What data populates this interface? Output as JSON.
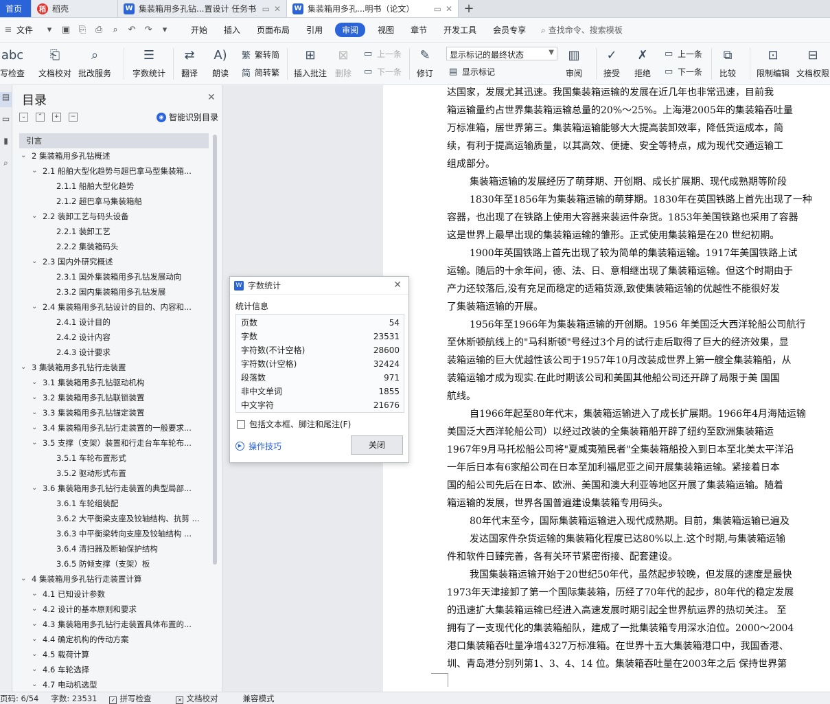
{
  "tabs": {
    "home": "首页",
    "daoke": "稻壳",
    "doc1": "集装箱用多孔钻...置设计 任务书",
    "doc2": "集装箱用多孔...明书（论文）",
    "add": "+"
  },
  "menu": {
    "file": "文件",
    "items": [
      "开始",
      "插入",
      "页面布局",
      "引用",
      "审阅",
      "视图",
      "章节",
      "开发工具",
      "会员专享"
    ],
    "selected": "审阅",
    "search": "查找命令、搜索模板"
  },
  "ribbon": {
    "spellcheck": "写检查",
    "doc_proof": "文档校对",
    "batch_service": "批改服务",
    "word_count": "字数统计",
    "translate": "翻译",
    "read_aloud": "朗读",
    "to_traditional": "繁转简",
    "to_simplified": "简转繁",
    "insert_comment": "插入批注",
    "delete": "删除",
    "prev_comment": "上一条",
    "next_comment": "下一条",
    "revise": "修订",
    "markup_combo": "显示标记的最终状态",
    "show_markup": "显示标记",
    "review": "审阅",
    "accept": "接受",
    "reject": "拒绝",
    "prev_change": "上一条",
    "next_change": "下一条",
    "compare": "比较",
    "restrict_edit": "限制编辑",
    "doc_rights": "文档权限"
  },
  "toc": {
    "title": "目录",
    "smart_button": "智能识别目录",
    "items": [
      {
        "text": "引言",
        "level": 0
      },
      {
        "text": "2 集装箱用多孔钻概述",
        "level": 1
      },
      {
        "text": "2.1 船舶大型化趋势与超巴拿马型集装箱...",
        "level": 2
      },
      {
        "text": "2.1.1 船舶大型化趋势",
        "level": 3
      },
      {
        "text": "2.1.2 超巴拿马集装箱船",
        "level": 3
      },
      {
        "text": "2.2 装卸工艺与码头设备",
        "level": 2
      },
      {
        "text": "2.2.1 装卸工艺",
        "level": 3
      },
      {
        "text": "2.2.2 集装箱码头",
        "level": 3
      },
      {
        "text": "2.3 国内外研究概述",
        "level": 2
      },
      {
        "text": "2.3.1 国外集装箱用多孔钻发展动向",
        "level": 3
      },
      {
        "text": "2.3.2 国内集装箱用多孔钻发展",
        "level": 3
      },
      {
        "text": "2.4 集装箱用多孔钻设计的目的、内容和...",
        "level": 2
      },
      {
        "text": "2.4.1 设计目的",
        "level": 3
      },
      {
        "text": "2.4.2 设计内容",
        "level": 3
      },
      {
        "text": "2.4.3 设计要求",
        "level": 3
      },
      {
        "text": "3 集装箱用多孔钻行走装置",
        "level": 1
      },
      {
        "text": "3.1 集装箱用多孔钻驱动机构",
        "level": 2
      },
      {
        "text": "3.2 集装箱用多孔钻联锁装置",
        "level": 2
      },
      {
        "text": "3.3 集装箱用多孔钻锚定装置",
        "level": 2
      },
      {
        "text": "3.4 集装箱用多孔钻行走装置的一般要求...",
        "level": 2
      },
      {
        "text": "3.5 支撑（支架）装置和行走台车车轮布...",
        "level": 2
      },
      {
        "text": "3.5.1 车轮布置形式",
        "level": 3
      },
      {
        "text": "3.5.2 驱动形式布置",
        "level": 3
      },
      {
        "text": "3.6 集装箱用多孔钻行走装置的典型局部...",
        "level": 2
      },
      {
        "text": "3.6.1 车轮组装配",
        "level": 3
      },
      {
        "text": "3.6.2 大平衡梁支座及铰轴结构、抗剪 ...",
        "level": 3
      },
      {
        "text": "3.6.3 中平衡梁转向支座及铰轴结构 ...",
        "level": 3
      },
      {
        "text": "3.6.4 清扫器及断轴保护结构",
        "level": 3
      },
      {
        "text": "3.6.5 防倾支撑（支架）板",
        "level": 3
      },
      {
        "text": "4 集装箱用多孔钻行走装置计算",
        "level": 1
      },
      {
        "text": "4.1 已知设计参数",
        "level": 2
      },
      {
        "text": "4.2 设计的基本原则和要求",
        "level": 2
      },
      {
        "text": "4.3 集装箱用多孔钻行走装置具体布置的...",
        "level": 2
      },
      {
        "text": "4.4 确定机构的传动方案",
        "level": 2
      },
      {
        "text": "4.5 载荷计算",
        "level": 2
      },
      {
        "text": "4.6 车轮选择",
        "level": 2
      },
      {
        "text": "4.7 电动机选型",
        "level": 2
      }
    ]
  },
  "dialog": {
    "title": "字数统计",
    "section": "统计信息",
    "rows": [
      {
        "label": "页数",
        "value": "54"
      },
      {
        "label": "字数",
        "value": "23531"
      },
      {
        "label": "字符数(不计空格)",
        "value": "28600"
      },
      {
        "label": "字符数(计空格)",
        "value": "32424"
      },
      {
        "label": "段落数",
        "value": "971"
      },
      {
        "label": "非中文单词",
        "value": "1855"
      },
      {
        "label": "中文字符",
        "value": "21676"
      }
    ],
    "checkbox": "包括文本框、脚注和尾注(F)",
    "tip": "操作技巧",
    "close": "关闭"
  },
  "document": {
    "lines": [
      {
        "text": "达国家，发展尤其迅速。我国集装箱运输的发展在近几年也非常迅速，目前我",
        "indent": false
      },
      {
        "text": "箱运输量约占世界集装箱运输总量的20%～25%。上海港2005年的集装箱吞吐量",
        "indent": false
      },
      {
        "text": "万标准箱，居世界第三。集装箱运输能够大大提高装卸效率，降低货运成本，简",
        "indent": false
      },
      {
        "text": "续，有利于提高运输质量，以其高效、便捷、安全等特点，成为现代交通运输工",
        "indent": false
      },
      {
        "text": "组成部分。",
        "indent": false
      },
      {
        "text": "集装箱运输的发展经历了萌芽期、开创期、成长扩展期、现代成熟期等阶段",
        "indent": true
      },
      {
        "text": "1830年至1856年为集装箱运输的萌芽期。1830年在英国铁路上首先出现了一种",
        "indent": true
      },
      {
        "text": "容器，也出现了在铁路上使用大容器来装运件杂货。1853年美国铁路也采用了容器",
        "indent": false
      },
      {
        "text": "这是世界上最早出现的集装箱运输的雏形。正式使用集装箱是在20 世纪初期。",
        "indent": false
      },
      {
        "text": "1900年英国铁路上首先出现了较为简单的集装箱运输。1917年美国铁路上试",
        "indent": true
      },
      {
        "text": "运输。随后的十余年间，德、法、日、意相继出现了集装箱运输。但这个时期由于",
        "indent": false
      },
      {
        "text": "产力还较落后,没有充足而稳定的适箱货源,致使集装箱运输的优越性不能很好发",
        "indent": false
      },
      {
        "text": "了集装箱运输的开展。",
        "indent": false
      },
      {
        "text": "1956年至1966年为集装箱运输的开创期。1956 年美国泛大西洋轮船公司航行",
        "indent": true
      },
      {
        "text": "至休斯顿航线上的\"马科斯顿\"号经过3个月的试行走后取得了巨大的经济效果，显",
        "indent": false
      },
      {
        "text": "装箱运输的巨大优越性该公司于1957年10月改装成世界上第一艘全集装箱船，从",
        "indent": false
      },
      {
        "text": "装箱运输才成为现实.在此时期该公司和美国其他船公司还开辟了局限于美 国国",
        "indent": false
      },
      {
        "text": "航线。",
        "indent": false
      },
      {
        "text": "自1966年起至80年代末，集装箱运输进入了成长扩展期。1966年4月海陆运输",
        "indent": true
      },
      {
        "text": "美国泛大西洋轮船公司）以经过改装的全集装箱船开辟了纽约至欧洲集装箱运",
        "indent": false
      },
      {
        "text": "1967年9月马托松船公司将\"夏威夷殖民者\"全集装箱船投入到日本至北美太平洋沿",
        "indent": false
      },
      {
        "text": "一年后日本有6家船公司在日本至加利福尼亚之间开展集装箱运输。紧接着日本",
        "indent": false
      },
      {
        "text": "国的船公司先后在日本、欧洲、美国和澳大利亚等地区开展了集装箱运输。随着",
        "indent": false
      },
      {
        "text": "箱运输的发展，世界各国普遍建设集装箱专用码头。",
        "indent": false
      },
      {
        "text": "80年代末至今，国际集装箱运输进入现代成熟期。目前，集装箱运输已遍及",
        "indent": true
      },
      {
        "text": "发达国家件杂货运输的集装箱化程度已达80%以上.这个时期,与集装箱运输",
        "indent": true
      },
      {
        "text": "件和软件日臻完善，各有关环节紧密衔接、配套建设。",
        "indent": false
      },
      {
        "text": "我国集装箱运输开始于20世纪50年代，虽然起步较晚，但发展的速度是最快",
        "indent": true
      },
      {
        "text": "1973年天津接卸了第一个国际集装箱，历经了70年代的起步，80年代的稳定发展",
        "indent": false
      },
      {
        "text": "的迅速扩大集装箱运输已经进入高速发展时期引起全世界航运界的热切关注。 至",
        "indent": false
      },
      {
        "text": "拥有了一支现代化的集装箱船队，建成了一批集装箱专用深水泊位。2000～2004",
        "indent": false
      },
      {
        "text": "港口集装箱吞吐量净增4327万标准箱。在世界十五大集装箱港口中，我国香港、",
        "indent": false
      },
      {
        "text": "圳、青岛港分别列第1、3、4、14 位。集装箱吞吐量在2003年之后 保持世界第",
        "indent": false
      }
    ]
  },
  "status": {
    "page": "页码: 6/54",
    "words": "字数: 23531",
    "spell": "拼写检查",
    "proof": "文档校对",
    "compat": "兼容模式"
  }
}
